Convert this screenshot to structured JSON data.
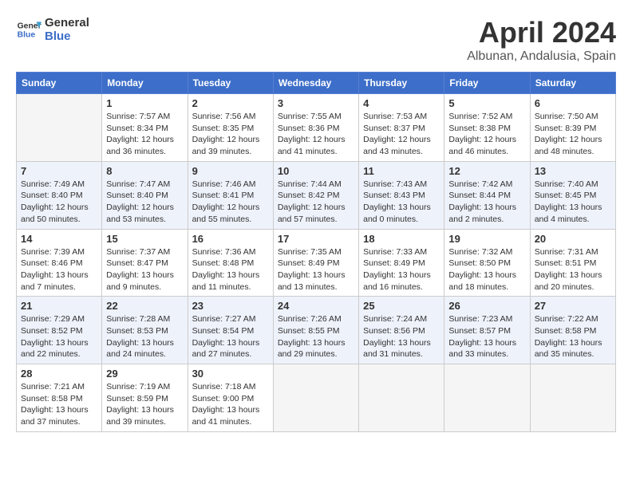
{
  "header": {
    "logo_line1": "General",
    "logo_line2": "Blue",
    "month_title": "April 2024",
    "location": "Albunan, Andalusia, Spain"
  },
  "weekdays": [
    "Sunday",
    "Monday",
    "Tuesday",
    "Wednesday",
    "Thursday",
    "Friday",
    "Saturday"
  ],
  "weeks": [
    [
      {
        "day": "",
        "sunrise": "",
        "sunset": "",
        "daylight": "",
        "empty": true
      },
      {
        "day": "1",
        "sunrise": "7:57 AM",
        "sunset": "8:34 PM",
        "daylight": "12 hours and 36 minutes."
      },
      {
        "day": "2",
        "sunrise": "7:56 AM",
        "sunset": "8:35 PM",
        "daylight": "12 hours and 39 minutes."
      },
      {
        "day": "3",
        "sunrise": "7:55 AM",
        "sunset": "8:36 PM",
        "daylight": "12 hours and 41 minutes."
      },
      {
        "day": "4",
        "sunrise": "7:53 AM",
        "sunset": "8:37 PM",
        "daylight": "12 hours and 43 minutes."
      },
      {
        "day": "5",
        "sunrise": "7:52 AM",
        "sunset": "8:38 PM",
        "daylight": "12 hours and 46 minutes."
      },
      {
        "day": "6",
        "sunrise": "7:50 AM",
        "sunset": "8:39 PM",
        "daylight": "12 hours and 48 minutes."
      }
    ],
    [
      {
        "day": "7",
        "sunrise": "7:49 AM",
        "sunset": "8:40 PM",
        "daylight": "12 hours and 50 minutes."
      },
      {
        "day": "8",
        "sunrise": "7:47 AM",
        "sunset": "8:40 PM",
        "daylight": "12 hours and 53 minutes."
      },
      {
        "day": "9",
        "sunrise": "7:46 AM",
        "sunset": "8:41 PM",
        "daylight": "12 hours and 55 minutes."
      },
      {
        "day": "10",
        "sunrise": "7:44 AM",
        "sunset": "8:42 PM",
        "daylight": "12 hours and 57 minutes."
      },
      {
        "day": "11",
        "sunrise": "7:43 AM",
        "sunset": "8:43 PM",
        "daylight": "13 hours and 0 minutes."
      },
      {
        "day": "12",
        "sunrise": "7:42 AM",
        "sunset": "8:44 PM",
        "daylight": "13 hours and 2 minutes."
      },
      {
        "day": "13",
        "sunrise": "7:40 AM",
        "sunset": "8:45 PM",
        "daylight": "13 hours and 4 minutes."
      }
    ],
    [
      {
        "day": "14",
        "sunrise": "7:39 AM",
        "sunset": "8:46 PM",
        "daylight": "13 hours and 7 minutes."
      },
      {
        "day": "15",
        "sunrise": "7:37 AM",
        "sunset": "8:47 PM",
        "daylight": "13 hours and 9 minutes."
      },
      {
        "day": "16",
        "sunrise": "7:36 AM",
        "sunset": "8:48 PM",
        "daylight": "13 hours and 11 minutes."
      },
      {
        "day": "17",
        "sunrise": "7:35 AM",
        "sunset": "8:49 PM",
        "daylight": "13 hours and 13 minutes."
      },
      {
        "day": "18",
        "sunrise": "7:33 AM",
        "sunset": "8:49 PM",
        "daylight": "13 hours and 16 minutes."
      },
      {
        "day": "19",
        "sunrise": "7:32 AM",
        "sunset": "8:50 PM",
        "daylight": "13 hours and 18 minutes."
      },
      {
        "day": "20",
        "sunrise": "7:31 AM",
        "sunset": "8:51 PM",
        "daylight": "13 hours and 20 minutes."
      }
    ],
    [
      {
        "day": "21",
        "sunrise": "7:29 AM",
        "sunset": "8:52 PM",
        "daylight": "13 hours and 22 minutes."
      },
      {
        "day": "22",
        "sunrise": "7:28 AM",
        "sunset": "8:53 PM",
        "daylight": "13 hours and 24 minutes."
      },
      {
        "day": "23",
        "sunrise": "7:27 AM",
        "sunset": "8:54 PM",
        "daylight": "13 hours and 27 minutes."
      },
      {
        "day": "24",
        "sunrise": "7:26 AM",
        "sunset": "8:55 PM",
        "daylight": "13 hours and 29 minutes."
      },
      {
        "day": "25",
        "sunrise": "7:24 AM",
        "sunset": "8:56 PM",
        "daylight": "13 hours and 31 minutes."
      },
      {
        "day": "26",
        "sunrise": "7:23 AM",
        "sunset": "8:57 PM",
        "daylight": "13 hours and 33 minutes."
      },
      {
        "day": "27",
        "sunrise": "7:22 AM",
        "sunset": "8:58 PM",
        "daylight": "13 hours and 35 minutes."
      }
    ],
    [
      {
        "day": "28",
        "sunrise": "7:21 AM",
        "sunset": "8:58 PM",
        "daylight": "13 hours and 37 minutes."
      },
      {
        "day": "29",
        "sunrise": "7:19 AM",
        "sunset": "8:59 PM",
        "daylight": "13 hours and 39 minutes."
      },
      {
        "day": "30",
        "sunrise": "7:18 AM",
        "sunset": "9:00 PM",
        "daylight": "13 hours and 41 minutes."
      },
      {
        "day": "",
        "sunrise": "",
        "sunset": "",
        "daylight": "",
        "empty": true
      },
      {
        "day": "",
        "sunrise": "",
        "sunset": "",
        "daylight": "",
        "empty": true
      },
      {
        "day": "",
        "sunrise": "",
        "sunset": "",
        "daylight": "",
        "empty": true
      },
      {
        "day": "",
        "sunrise": "",
        "sunset": "",
        "daylight": "",
        "empty": true
      }
    ]
  ]
}
